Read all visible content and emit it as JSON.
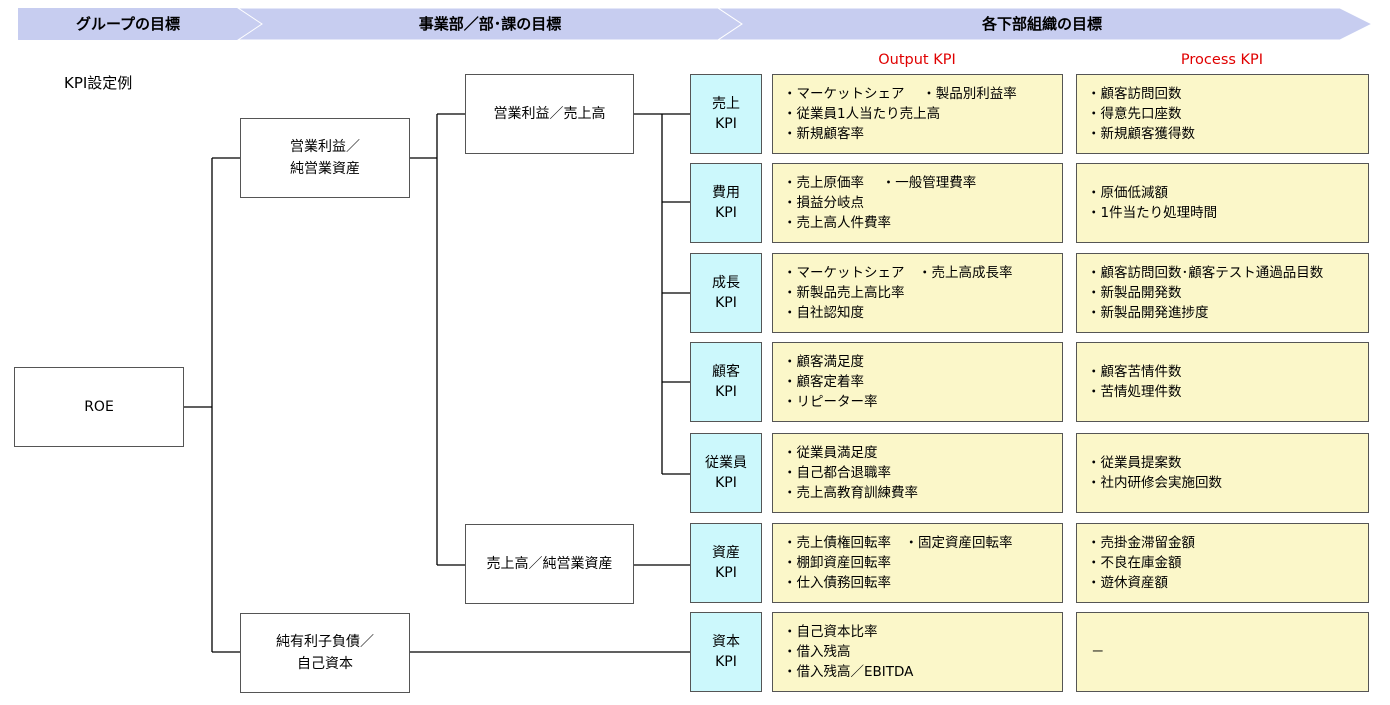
{
  "header": {
    "group": "グループの目標",
    "division": "事業部／部･課の目標",
    "sub": "各下部組織の目標",
    "bar_color": "#c7cdf0"
  },
  "section_label": "KPI設定例",
  "column_headers": {
    "output": "Output KPI",
    "process": "Process KPI",
    "color": "#e00000"
  },
  "tree": {
    "root": "ROE",
    "level1": [
      [
        "営業利益／",
        "純営業資産"
      ],
      [
        "純有利子負債／",
        "自己資本"
      ]
    ],
    "level2": [
      "営業利益／売上高",
      "売上高／純営業資産"
    ]
  },
  "kpis": [
    {
      "name": [
        "売上",
        "KPI"
      ],
      "output": [
        "・マーケットシェア　 ・製品別利益率",
        "・従業員1人当たり売上高",
        "・新規顧客率"
      ],
      "process": [
        "・顧客訪問回数",
        "・得意先口座数",
        "・新規顧客獲得数"
      ]
    },
    {
      "name": [
        "費用",
        "KPI"
      ],
      "output": [
        "・売上原価率　 ・一般管理費率",
        "・損益分岐点",
        "・売上高人件費率"
      ],
      "process": [
        "・原価低減額",
        "・1件当たり処理時間"
      ]
    },
    {
      "name": [
        "成長",
        "KPI"
      ],
      "output": [
        "・マーケットシェア　・売上高成長率",
        "・新製品売上高比率",
        "・自社認知度"
      ],
      "process": [
        "・顧客訪問回数･顧客テスト通過品目数",
        "・新製品開発数",
        "・新製品開発進捗度"
      ]
    },
    {
      "name": [
        "顧客",
        "KPI"
      ],
      "output": [
        "・顧客満足度",
        "・顧客定着率",
        "・リピーター率"
      ],
      "process": [
        "・顧客苦情件数",
        "・苦情処理件数"
      ]
    },
    {
      "name": [
        "従業員",
        "KPI"
      ],
      "output": [
        "・従業員満足度",
        "・自己都合退職率",
        "・売上高教育訓練費率"
      ],
      "process": [
        "・従業員提案数",
        "・社内研修会実施回数"
      ]
    },
    {
      "name": [
        "資産",
        "KPI"
      ],
      "output": [
        "・売上債権回転率　・固定資産回転率",
        "・棚卸資産回転率",
        "・仕入債務回転率"
      ],
      "process": [
        "・売掛金滞留金額",
        "・不良在庫金額",
        "・遊休資産額"
      ]
    },
    {
      "name": [
        "資本",
        "KPI"
      ],
      "output": [
        "・自己資本比率",
        "・借入残高",
        "・借入残高／EBITDA"
      ],
      "process": [
        "－"
      ]
    }
  ],
  "colors": {
    "kpi_fill": "#ccf8fc",
    "cell_fill": "#fbf7c9",
    "line": "#000000"
  }
}
